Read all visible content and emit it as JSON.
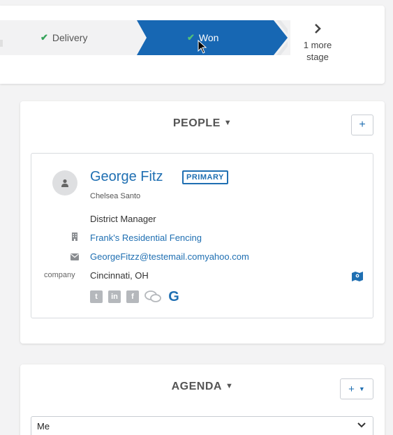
{
  "pipeline": {
    "stages": [
      {
        "label": "Delivery",
        "status": "complete"
      },
      {
        "label": "Won",
        "status": "current"
      }
    ],
    "more_stages_line1": "1 more",
    "more_stages_line2": "stage",
    "colors": {
      "current": "#1767b3",
      "check": "#35a35a",
      "track": "#f2f2f3"
    }
  },
  "people": {
    "title": "PEOPLE",
    "add_label": "+",
    "contact": {
      "name": "George Fitz",
      "badge": "PRIMARY",
      "owner": "Chelsea Santo",
      "job_title": "District Manager",
      "company": "Frank's Residential Fencing",
      "email": "GeorgeFitzz@testemail.comyahoo.com",
      "location_label": "company",
      "location": "Cincinnati, OH",
      "socials": [
        "twitter-icon",
        "linkedin-icon",
        "facebook-icon",
        "chat-icon",
        "google-icon"
      ]
    }
  },
  "agenda": {
    "title": "AGENDA",
    "add_label": "+",
    "selected": "Me"
  },
  "colors": {
    "accent": "#1f6fb2",
    "muted_icon": "#b5b8bc"
  }
}
